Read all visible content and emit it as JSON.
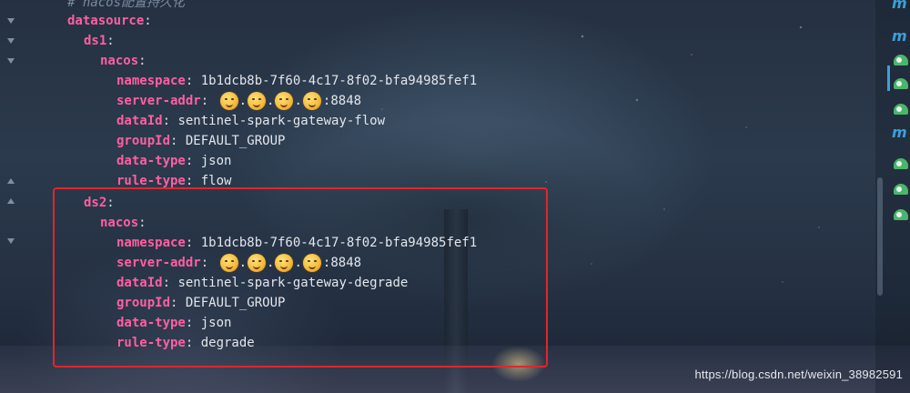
{
  "editor": {
    "comment_prefix": "#",
    "comment_word": "nacos",
    "comment_rest": "配置持久化",
    "lines": {
      "datasource_key": "datasource",
      "ds1_key": "ds1",
      "ds1_nacos_key": "nacos",
      "ds1_namespace_key": "namespace",
      "ds1_namespace_val": "1b1dcb8b-7f60-4c17-8f02-bfa94985fef1",
      "ds1_server_addr_key": "server-addr",
      "ds1_server_addr_port": ":8848",
      "ds1_dataid_key": "dataId",
      "ds1_dataid_val": "sentinel-spark-gateway-flow",
      "ds1_groupid_key": "groupId",
      "ds1_groupid_val": "DEFAULT_GROUP",
      "ds1_datatype_key": "data-type",
      "ds1_datatype_val": "json",
      "ds1_ruletype_key": "rule-type",
      "ds1_ruletype_val": "flow",
      "ds2_key": "ds2",
      "ds2_nacos_key": "nacos",
      "ds2_namespace_key": "namespace",
      "ds2_namespace_val": "1b1dcb8b-7f60-4c17-8f02-bfa94985fef1",
      "ds2_server_addr_key": "server-addr",
      "ds2_server_addr_port": ":8848",
      "ds2_dataid_key": "dataId",
      "ds2_dataid_val": "sentinel-spark-gateway-degrade",
      "ds2_groupid_key": "groupId",
      "ds2_groupid_val": "DEFAULT_GROUP",
      "ds2_datatype_key": "data-type",
      "ds2_datatype_val": "json",
      "ds2_ruletype_key": "rule-type",
      "ds2_ruletype_val": "degrade"
    }
  },
  "highlight_color": "#e0262b",
  "key_color": "#ff5fa2",
  "right_panel": {
    "icons": [
      "maven-m-icon",
      "maven-m-icon",
      "leaf-gear-icon",
      "leaf-gear-icon",
      "leaf-gear-icon",
      "maven-m-icon",
      "leaf-gear-icon",
      "leaf-gear-icon",
      "leaf-gear-icon"
    ],
    "m_label": "m"
  },
  "watermark": "https://blog.csdn.net/weixin_38982591"
}
